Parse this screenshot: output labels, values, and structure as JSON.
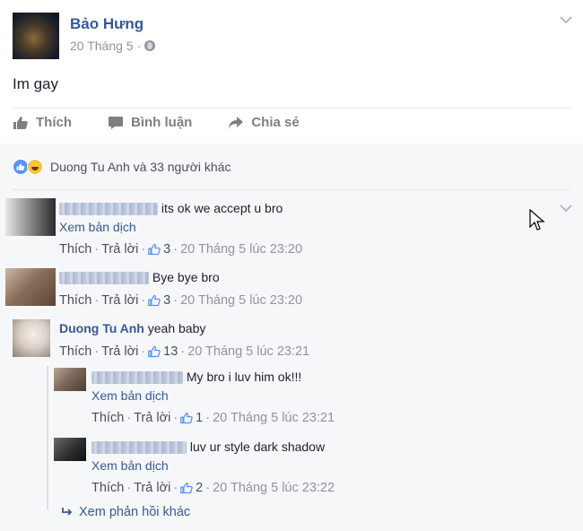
{
  "post": {
    "author": "Bảo Hưng",
    "date": "20 Tháng 5",
    "privacy_separator": "·",
    "text": "Im gay"
  },
  "actions": {
    "like": "Thích",
    "comment": "Bình luận",
    "share": "Chia sẻ"
  },
  "reactions": {
    "summary": "Duong Tu Anh và 33 người khác",
    "icons": [
      "like-icon",
      "haha-icon"
    ]
  },
  "comments": [
    {
      "author": "",
      "text": "its ok we accept u bro",
      "translate": "Xem bản dịch",
      "like": "Thích",
      "reply": "Trả lời",
      "likes": "3",
      "time": "20 Tháng 5 lúc 23:20"
    },
    {
      "author": "",
      "text": "Bye bye bro",
      "like": "Thích",
      "reply": "Trả lời",
      "likes": "3",
      "time": "20 Tháng 5 lúc 23:20"
    },
    {
      "author": "Duong Tu Anh",
      "text": "yeah baby",
      "like": "Thích",
      "reply": "Trả lời",
      "likes": "13",
      "time": "20 Tháng 5 lúc 23:21"
    }
  ],
  "replies": [
    {
      "author": "",
      "text": "My bro i luv him ok!!!",
      "translate": "Xem bản dịch",
      "like": "Thích",
      "reply": "Trả lời",
      "likes": "1",
      "time": "20 Tháng 5 lúc 23:21"
    },
    {
      "author": "",
      "text": "luv ur style dark shadow",
      "translate": "Xem bản dịch",
      "like": "Thích",
      "reply": "Trả lời",
      "likes": "2",
      "time": "20 Tháng 5 lúc 23:22"
    }
  ],
  "more_replies": "Xem phản hồi khác",
  "sep": "·"
}
